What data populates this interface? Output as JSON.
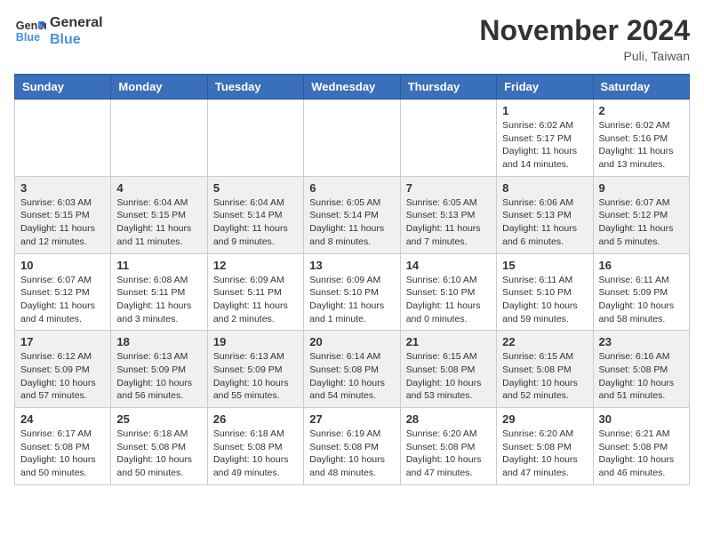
{
  "logo": {
    "line1": "General",
    "line2": "Blue"
  },
  "title": "November 2024",
  "location": "Puli, Taiwan",
  "weekdays": [
    "Sunday",
    "Monday",
    "Tuesday",
    "Wednesday",
    "Thursday",
    "Friday",
    "Saturday"
  ],
  "weeks": [
    [
      {
        "day": "",
        "info": ""
      },
      {
        "day": "",
        "info": ""
      },
      {
        "day": "",
        "info": ""
      },
      {
        "day": "",
        "info": ""
      },
      {
        "day": "",
        "info": ""
      },
      {
        "day": "1",
        "info": "Sunrise: 6:02 AM\nSunset: 5:17 PM\nDaylight: 11 hours and 14 minutes."
      },
      {
        "day": "2",
        "info": "Sunrise: 6:02 AM\nSunset: 5:16 PM\nDaylight: 11 hours and 13 minutes."
      }
    ],
    [
      {
        "day": "3",
        "info": "Sunrise: 6:03 AM\nSunset: 5:15 PM\nDaylight: 11 hours and 12 minutes."
      },
      {
        "day": "4",
        "info": "Sunrise: 6:04 AM\nSunset: 5:15 PM\nDaylight: 11 hours and 11 minutes."
      },
      {
        "day": "5",
        "info": "Sunrise: 6:04 AM\nSunset: 5:14 PM\nDaylight: 11 hours and 9 minutes."
      },
      {
        "day": "6",
        "info": "Sunrise: 6:05 AM\nSunset: 5:14 PM\nDaylight: 11 hours and 8 minutes."
      },
      {
        "day": "7",
        "info": "Sunrise: 6:05 AM\nSunset: 5:13 PM\nDaylight: 11 hours and 7 minutes."
      },
      {
        "day": "8",
        "info": "Sunrise: 6:06 AM\nSunset: 5:13 PM\nDaylight: 11 hours and 6 minutes."
      },
      {
        "day": "9",
        "info": "Sunrise: 6:07 AM\nSunset: 5:12 PM\nDaylight: 11 hours and 5 minutes."
      }
    ],
    [
      {
        "day": "10",
        "info": "Sunrise: 6:07 AM\nSunset: 5:12 PM\nDaylight: 11 hours and 4 minutes."
      },
      {
        "day": "11",
        "info": "Sunrise: 6:08 AM\nSunset: 5:11 PM\nDaylight: 11 hours and 3 minutes."
      },
      {
        "day": "12",
        "info": "Sunrise: 6:09 AM\nSunset: 5:11 PM\nDaylight: 11 hours and 2 minutes."
      },
      {
        "day": "13",
        "info": "Sunrise: 6:09 AM\nSunset: 5:10 PM\nDaylight: 11 hours and 1 minute."
      },
      {
        "day": "14",
        "info": "Sunrise: 6:10 AM\nSunset: 5:10 PM\nDaylight: 11 hours and 0 minutes."
      },
      {
        "day": "15",
        "info": "Sunrise: 6:11 AM\nSunset: 5:10 PM\nDaylight: 10 hours and 59 minutes."
      },
      {
        "day": "16",
        "info": "Sunrise: 6:11 AM\nSunset: 5:09 PM\nDaylight: 10 hours and 58 minutes."
      }
    ],
    [
      {
        "day": "17",
        "info": "Sunrise: 6:12 AM\nSunset: 5:09 PM\nDaylight: 10 hours and 57 minutes."
      },
      {
        "day": "18",
        "info": "Sunrise: 6:13 AM\nSunset: 5:09 PM\nDaylight: 10 hours and 56 minutes."
      },
      {
        "day": "19",
        "info": "Sunrise: 6:13 AM\nSunset: 5:09 PM\nDaylight: 10 hours and 55 minutes."
      },
      {
        "day": "20",
        "info": "Sunrise: 6:14 AM\nSunset: 5:08 PM\nDaylight: 10 hours and 54 minutes."
      },
      {
        "day": "21",
        "info": "Sunrise: 6:15 AM\nSunset: 5:08 PM\nDaylight: 10 hours and 53 minutes."
      },
      {
        "day": "22",
        "info": "Sunrise: 6:15 AM\nSunset: 5:08 PM\nDaylight: 10 hours and 52 minutes."
      },
      {
        "day": "23",
        "info": "Sunrise: 6:16 AM\nSunset: 5:08 PM\nDaylight: 10 hours and 51 minutes."
      }
    ],
    [
      {
        "day": "24",
        "info": "Sunrise: 6:17 AM\nSunset: 5:08 PM\nDaylight: 10 hours and 50 minutes."
      },
      {
        "day": "25",
        "info": "Sunrise: 6:18 AM\nSunset: 5:08 PM\nDaylight: 10 hours and 50 minutes."
      },
      {
        "day": "26",
        "info": "Sunrise: 6:18 AM\nSunset: 5:08 PM\nDaylight: 10 hours and 49 minutes."
      },
      {
        "day": "27",
        "info": "Sunrise: 6:19 AM\nSunset: 5:08 PM\nDaylight: 10 hours and 48 minutes."
      },
      {
        "day": "28",
        "info": "Sunrise: 6:20 AM\nSunset: 5:08 PM\nDaylight: 10 hours and 47 minutes."
      },
      {
        "day": "29",
        "info": "Sunrise: 6:20 AM\nSunset: 5:08 PM\nDaylight: 10 hours and 47 minutes."
      },
      {
        "day": "30",
        "info": "Sunrise: 6:21 AM\nSunset: 5:08 PM\nDaylight: 10 hours and 46 minutes."
      }
    ]
  ]
}
